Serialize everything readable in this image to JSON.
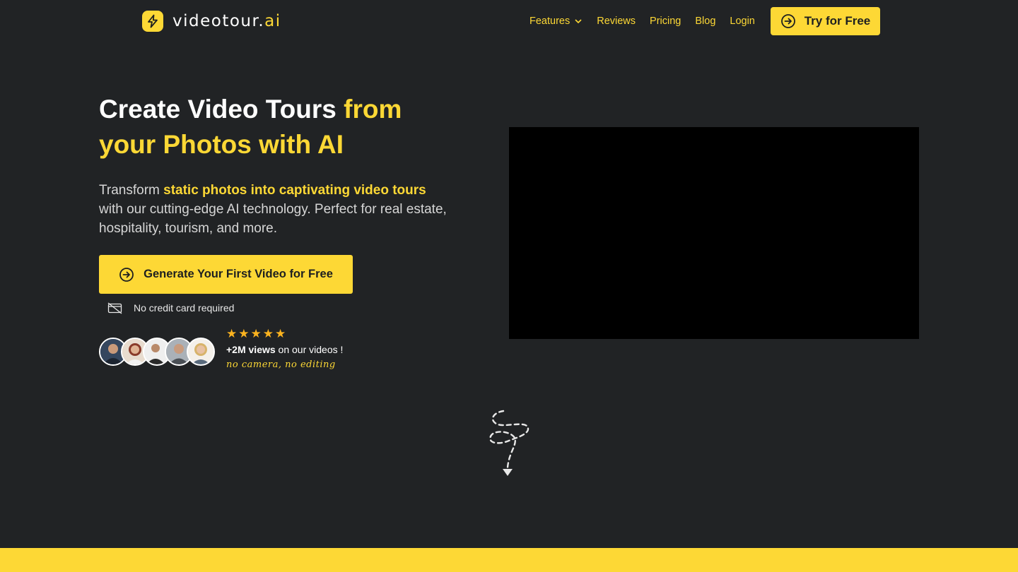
{
  "brand": {
    "name_main": "videotour.",
    "name_suffix": "ai",
    "logo_icon": "lightning-bolt-icon",
    "accent_color": "#fdd835",
    "background_color": "#212325"
  },
  "nav": {
    "features": "Features",
    "reviews": "Reviews",
    "pricing": "Pricing",
    "blog": "Blog",
    "login": "Login",
    "cta": "Try for Free"
  },
  "hero": {
    "title_white": "Create Video Tours ",
    "title_yellow_1": "from",
    "title_yellow_2": "your Photos with AI",
    "sub_pre": "Transform ",
    "sub_bold": "static photos into captivating video tours",
    "sub_post": " with our cutting-edge AI technology. Perfect for real estate, hospitality, tourism, and more.",
    "cta": "Generate Your First Video for Free",
    "no_card": "No credit card required"
  },
  "social_proof": {
    "stars": 5,
    "views_bold": "+2M views",
    "views_rest": " on our videos !",
    "tagline": "no camera, no editing"
  }
}
